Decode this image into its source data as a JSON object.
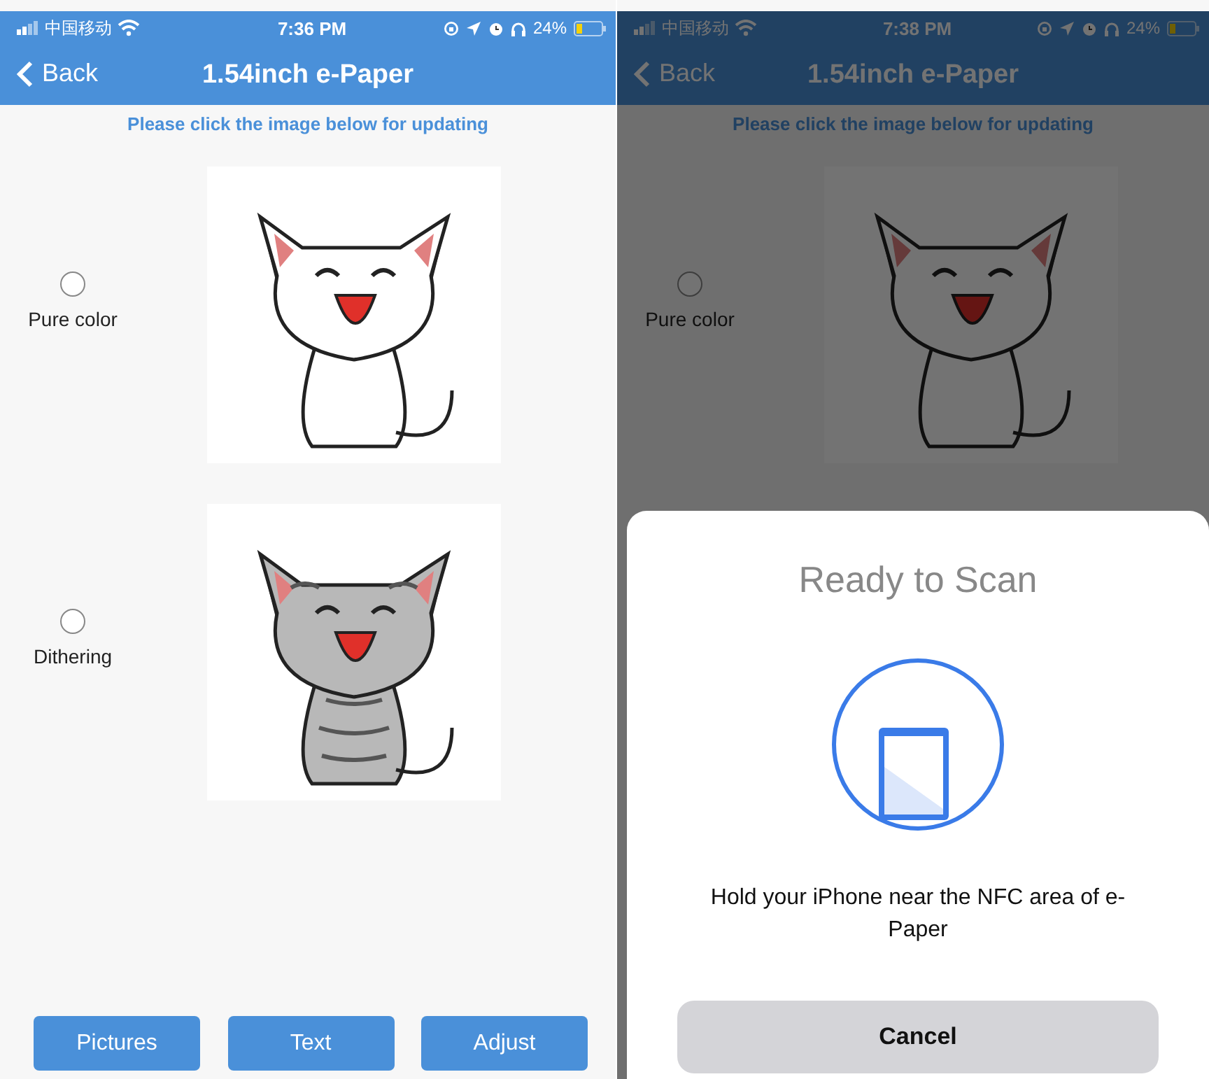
{
  "screens": [
    {
      "status_bar": {
        "carrier": "中国移动",
        "time": "7:36 PM",
        "battery": "24%"
      },
      "nav": {
        "back": "Back",
        "title": "1.54inch e-Paper"
      },
      "dimmed": false,
      "hint": "Please click the image below for updating",
      "options": [
        {
          "label": "Pure color",
          "selected": false,
          "kind": "plain"
        },
        {
          "label": "Dithering",
          "selected": false,
          "kind": "dithered"
        }
      ],
      "buttons": [
        "Pictures",
        "Text",
        "Adjust"
      ]
    },
    {
      "status_bar": {
        "carrier": "中国移动",
        "time": "7:38 PM",
        "battery": "24%"
      },
      "nav": {
        "back": "Back",
        "title": "1.54inch e-Paper"
      },
      "dimmed": true,
      "hint": "Please click the image below for updating",
      "options": [
        {
          "label": "Pure color",
          "selected": false,
          "kind": "plain"
        }
      ],
      "sheet": {
        "title": "Ready to Scan",
        "message": "Hold your iPhone near the NFC area of e-Paper",
        "cancel": "Cancel"
      }
    }
  ]
}
